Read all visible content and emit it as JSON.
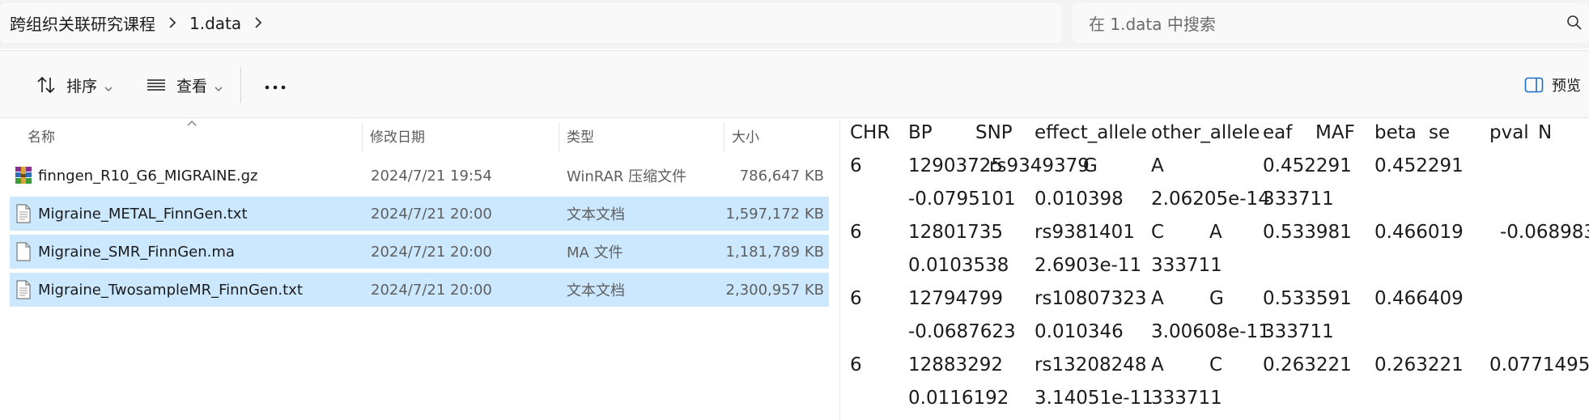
{
  "breadcrumb": {
    "items": [
      "跨组织关联研究课程",
      "1.data"
    ]
  },
  "search": {
    "placeholder": "在 1.data 中搜索"
  },
  "toolbar": {
    "sort_label": "排序",
    "view_label": "查看",
    "preview_label": "预览"
  },
  "columns": {
    "name": "名称",
    "date": "修改日期",
    "type": "类型",
    "size": "大小"
  },
  "files": [
    {
      "name": "finngen_R10_G6_MIGRAINE.gz",
      "date": "2024/7/21 19:54",
      "type": "WinRAR 压缩文件",
      "size": "786,647 KB",
      "icon": "winrar-archive-icon",
      "selected": false
    },
    {
      "name": "Migraine_METAL_FinnGen.txt",
      "date": "2024/7/21 20:00",
      "type": "文本文档",
      "size": "1,597,172 KB",
      "icon": "text-file-icon",
      "selected": true
    },
    {
      "name": "Migraine_SMR_FinnGen.ma",
      "date": "2024/7/21 20:00",
      "type": "MA 文件",
      "size": "1,181,789 KB",
      "icon": "generic-file-icon",
      "selected": true
    },
    {
      "name": "Migraine_TwosampleMR_FinnGen.txt",
      "date": "2024/7/21 20:00",
      "type": "文本文档",
      "size": "2,300,957 KB",
      "icon": "text-file-icon",
      "selected": true
    }
  ],
  "preview": {
    "header": [
      "CHR",
      "BP",
      "SNP",
      "effect_allele",
      "other_allele",
      "eaf",
      "MAF",
      "beta",
      "se",
      "pval",
      "N"
    ],
    "records": [
      {
        "line1": [
          "6",
          "12903725",
          "rs9349379",
          "G",
          "A",
          "0.452291",
          "0.452291",
          ""
        ],
        "line2": [
          "-0.0795101",
          "0.010398",
          "2.06205e-14",
          "333711"
        ]
      },
      {
        "line1": [
          "6",
          "12801735",
          "rs9381401",
          "C",
          "A",
          "0.533981",
          "0.466019",
          "-0.068983"
        ],
        "line2": [
          "0.0103538",
          "2.6903e-11",
          "333711",
          ""
        ]
      },
      {
        "line1": [
          "6",
          "12794799",
          "rs10807323",
          "A",
          "G",
          "0.533591",
          "0.466409",
          ""
        ],
        "line2": [
          "-0.0687623",
          "0.010346",
          "3.00608e-11",
          "333711"
        ]
      },
      {
        "line1": [
          "6",
          "12883292",
          "rs13208248",
          "A",
          "C",
          "0.263221",
          "0.263221",
          "0.0771495"
        ],
        "line2": [
          "0.0116192",
          "3.14051e-11",
          "333711",
          ""
        ]
      }
    ]
  }
}
